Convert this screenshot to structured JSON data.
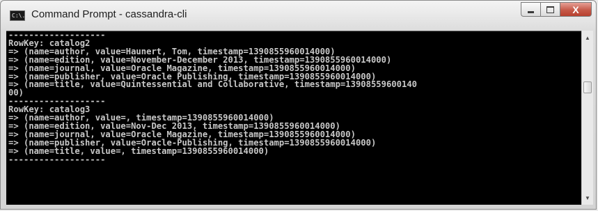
{
  "window": {
    "title": "Command Prompt - cassandra-cli",
    "icon": "cmd-icon",
    "icon_text": "C:\\."
  },
  "buttons": {
    "minimize": "minimize-icon",
    "maximize": "maximize-icon",
    "close": "close-icon",
    "close_glyph": "X"
  },
  "console": {
    "lines": [
      "-------------------",
      "RowKey: catalog2",
      "=> (name=author, value=Haunert, Tom, timestamp=1390855960014000)",
      "=> (name=edition, value=November-December 2013, timestamp=1390855960014000)",
      "=> (name=journal, value=Oracle Magazine, timestamp=1390855960014000)",
      "=> (name=publisher, value=Oracle Publishing, timestamp=1390855960014000)",
      "=> (name=title, value=Quintessential and Collaborative, timestamp=13908559600140",
      "00)",
      "-------------------",
      "RowKey: catalog3",
      "=> (name=author, value=, timestamp=1390855960014000)",
      "=> (name=edition, value=Nov-Dec 2013, timestamp=1390855960014000)",
      "=> (name=journal, value=Oracle Magazine, timestamp=1390855960014000)",
      "=> (name=publisher, value=Oracle-Publishing, timestamp=1390855960014000)",
      "=> (name=title, value=, timestamp=1390855960014000)",
      "-------------------"
    ]
  },
  "scrollbar": {
    "up_arrow": "▲",
    "down_arrow": "▼"
  },
  "colors": {
    "console_bg": "#000000",
    "console_fg": "#c8c8c8",
    "close_button": "#c65a49"
  }
}
